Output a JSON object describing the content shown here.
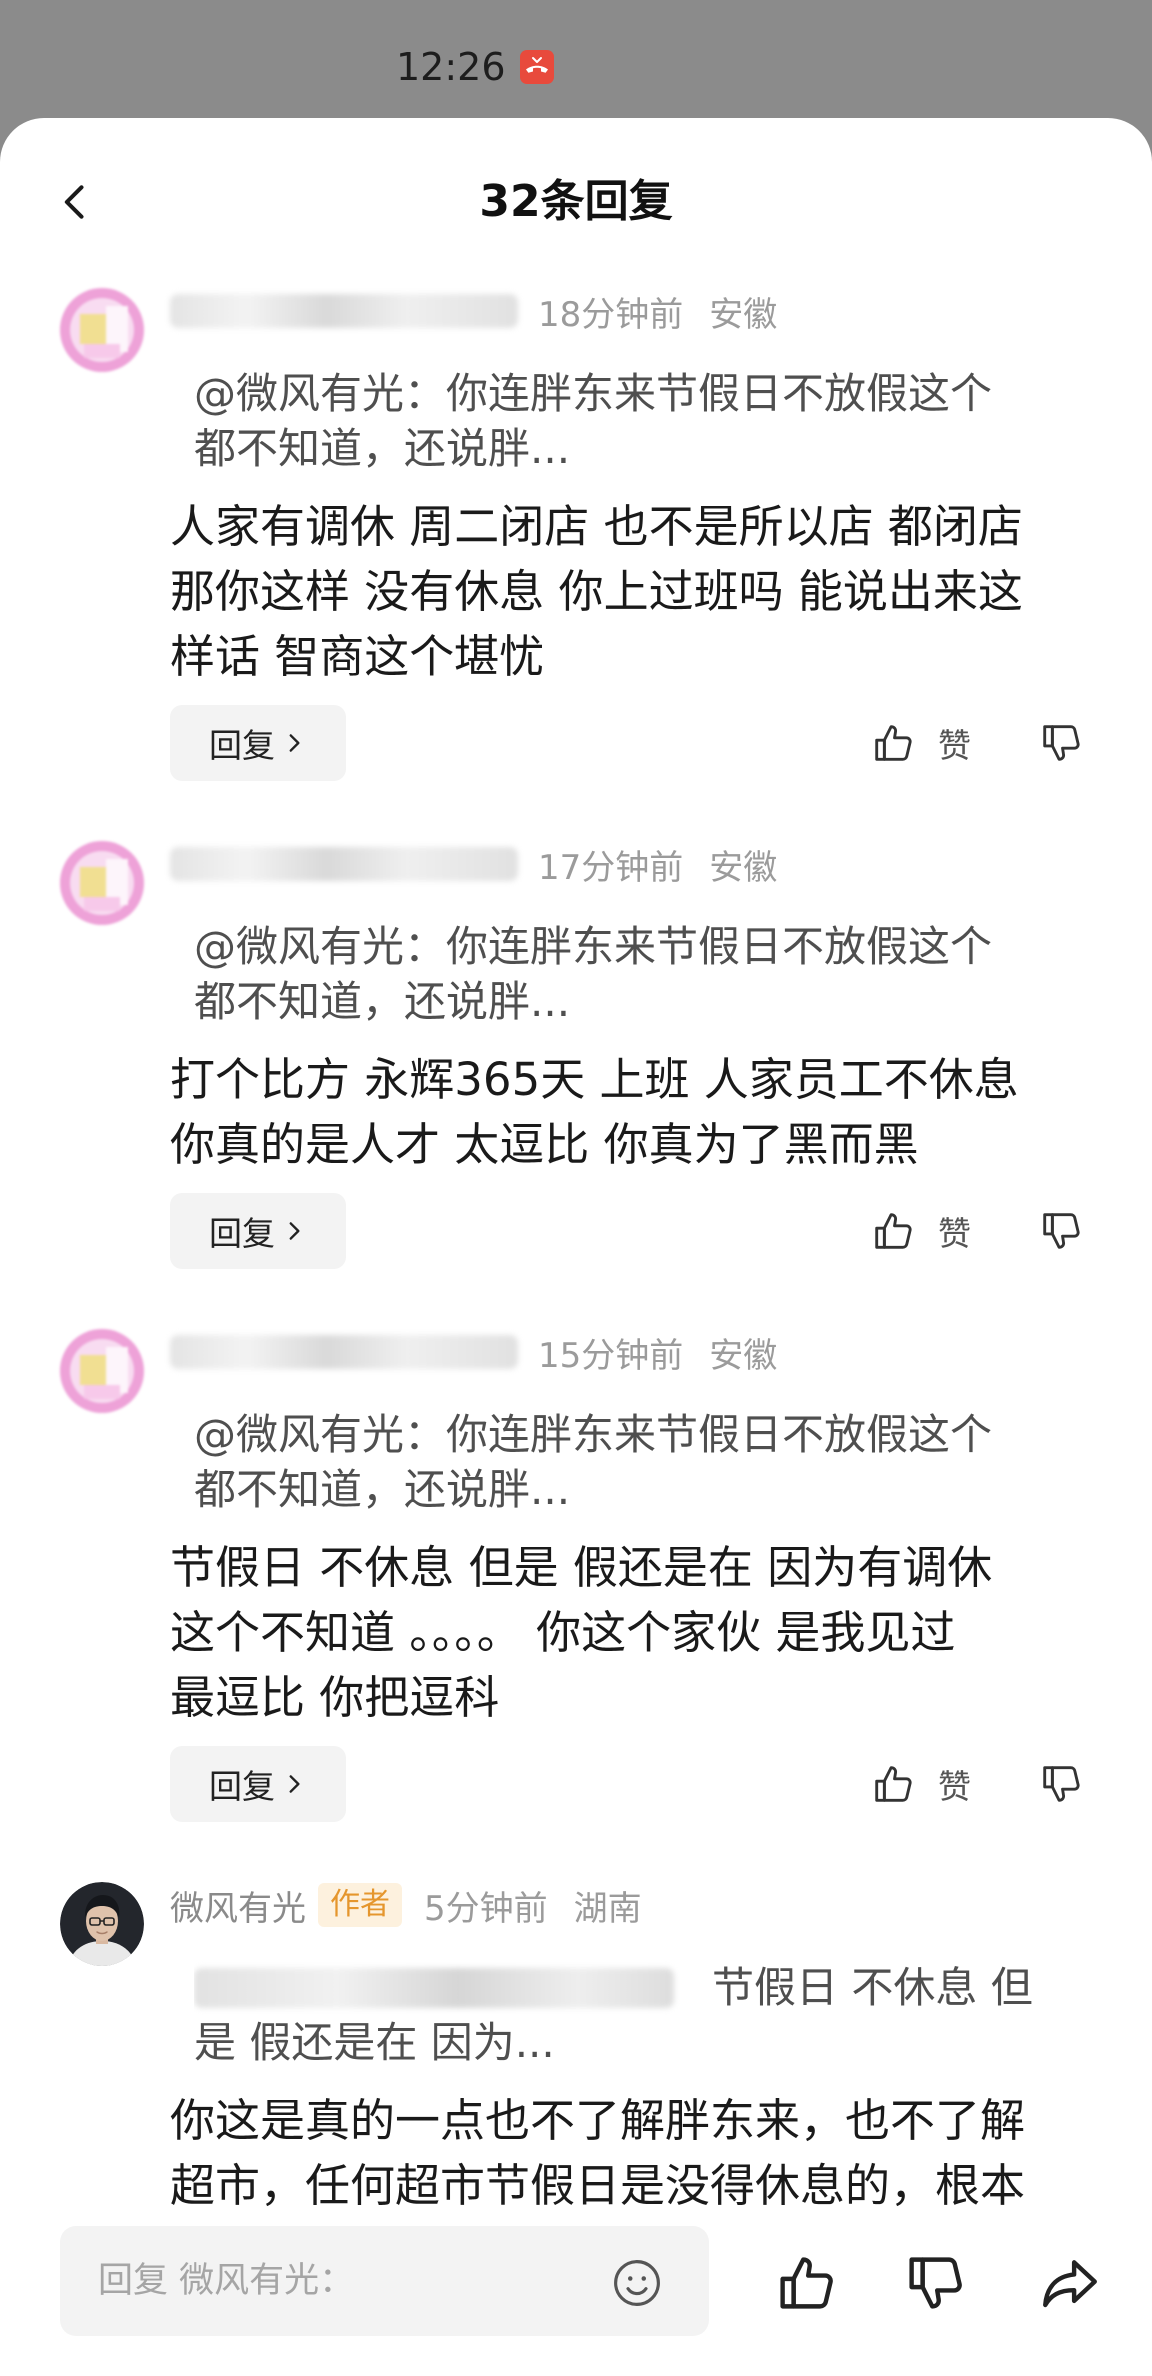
{
  "status_bar": {
    "time": "12:26",
    "notification_icon": "missed-call-icon"
  },
  "header": {
    "title": "32条回复",
    "back_icon": "chevron-left-icon"
  },
  "comments": [
    {
      "time": "18分钟前",
      "location": "安徽",
      "quote_lines": [
        "@微风有光：你连胖东来节假日不放假这个",
        "都不知道，还说胖..."
      ],
      "body_lines": [
        "人家有调休 周二闭店 也不是所以店 都闭店",
        "那你这样 没有休息 你上过班吗 能说出来这",
        "样话 智商这个堪忧"
      ],
      "reply_label": "回复",
      "like_label": "赞"
    },
    {
      "time": "17分钟前",
      "location": "安徽",
      "quote_lines": [
        "@微风有光：你连胖东来节假日不放假这个",
        "都不知道，还说胖..."
      ],
      "body_lines": [
        "打个比方 永辉365天 上班 人家员工不休息",
        "你真的是人才 太逗比 你真为了黑而黑"
      ],
      "reply_label": "回复",
      "like_label": "赞"
    },
    {
      "time": "15分钟前",
      "location": "安徽",
      "quote_lines": [
        "@微风有光：你连胖东来节假日不放假这个",
        "都不知道，还说胖..."
      ],
      "body_lines": [
        "节假日 不休息 但是 假还是在 因为有调休",
        "这个不知道 。。。。 你这个家伙 是我见过",
        "最逗比 你把逗科"
      ],
      "reply_label": "回复",
      "like_label": "赞"
    },
    {
      "author_name": "微风有光",
      "author_badge": "作者",
      "time": "5分钟前",
      "location": "湖南",
      "quote_lines": [
        "节假日 不休息 但",
        "是 假还是在 因为..."
      ],
      "body_lines": [
        "你这是真的一点也不了解胖东来，也不了解",
        "超市，任何超市节假日是没得休息的，根本"
      ]
    }
  ],
  "reply_bar": {
    "placeholder": "回复 微风有光：",
    "emoji_icon": "smiley-icon",
    "like_icon": "thumbs-up-icon",
    "dislike_icon": "thumbs-down-icon",
    "share_icon": "share-icon"
  },
  "colors": {
    "overlay_background": "#8b8b8b",
    "sheet_background": "#ffffff",
    "text_primary": "#1a1a1a",
    "text_secondary": "#9b9b9b",
    "quote_text": "#4f4f4f",
    "author_badge_text": "#e5962d",
    "author_badge_background": "#fdf1de",
    "button_background": "#f3f3f3",
    "notification_red": "#e84a3c"
  }
}
